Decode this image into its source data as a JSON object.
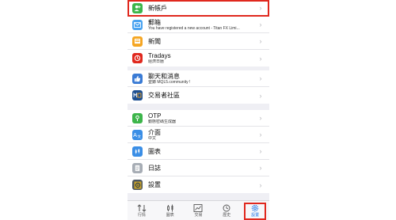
{
  "groups": [
    {
      "items": [
        {
          "name": "new-account",
          "title": "新帳戶",
          "subtitle": "",
          "icon": "add-user-icon",
          "color": "#3cb54a"
        },
        {
          "name": "mailbox",
          "title": "郵箱",
          "subtitle": "You have registered a new account - Titan FX Limi...",
          "icon": "mail-icon",
          "color": "#4aa3f0"
        },
        {
          "name": "news",
          "title": "新聞",
          "subtitle": "",
          "icon": "news-icon",
          "color": "#f5a623"
        },
        {
          "name": "tradays",
          "title": "Tradays",
          "subtitle": "經濟日曆",
          "icon": "tradays-icon",
          "color": "#e0281e"
        }
      ]
    },
    {
      "items": [
        {
          "name": "chat",
          "title": "聊天和消息",
          "subtitle": "登錄 MQL5.community !",
          "icon": "thumbs-up-icon",
          "color": "#3a7bd5"
        },
        {
          "name": "traders-community",
          "title": "交易者社區",
          "subtitle": "",
          "icon": "mql5-icon",
          "color": "#1d4f91"
        }
      ]
    },
    {
      "items": [
        {
          "name": "otp",
          "title": "OTP",
          "subtitle": "動態密碼生成器",
          "icon": "otp-icon",
          "color": "#3cb54a"
        },
        {
          "name": "interface",
          "title": "介面",
          "subtitle": "中文",
          "icon": "language-icon",
          "color": "#3a8ee6"
        },
        {
          "name": "charts",
          "title": "圖表",
          "subtitle": "",
          "icon": "candles-icon",
          "color": "#3a8ee6"
        },
        {
          "name": "journal",
          "title": "日誌",
          "subtitle": "",
          "icon": "journal-icon",
          "color": "#a7adb5"
        },
        {
          "name": "settings",
          "title": "設置",
          "subtitle": "",
          "icon": "gear-icon",
          "color": "#4a5560"
        }
      ]
    }
  ],
  "tabs": [
    {
      "label": "行情",
      "icon": "quotes-icon"
    },
    {
      "label": "圖表",
      "icon": "chart-icon"
    },
    {
      "label": "交易",
      "icon": "trade-icon"
    },
    {
      "label": "歷史",
      "icon": "history-icon"
    },
    {
      "label": "設置",
      "icon": "settings-icon",
      "active": true
    }
  ],
  "colors": {
    "accent": "#1a73e8",
    "highlight": "#e0281e"
  }
}
